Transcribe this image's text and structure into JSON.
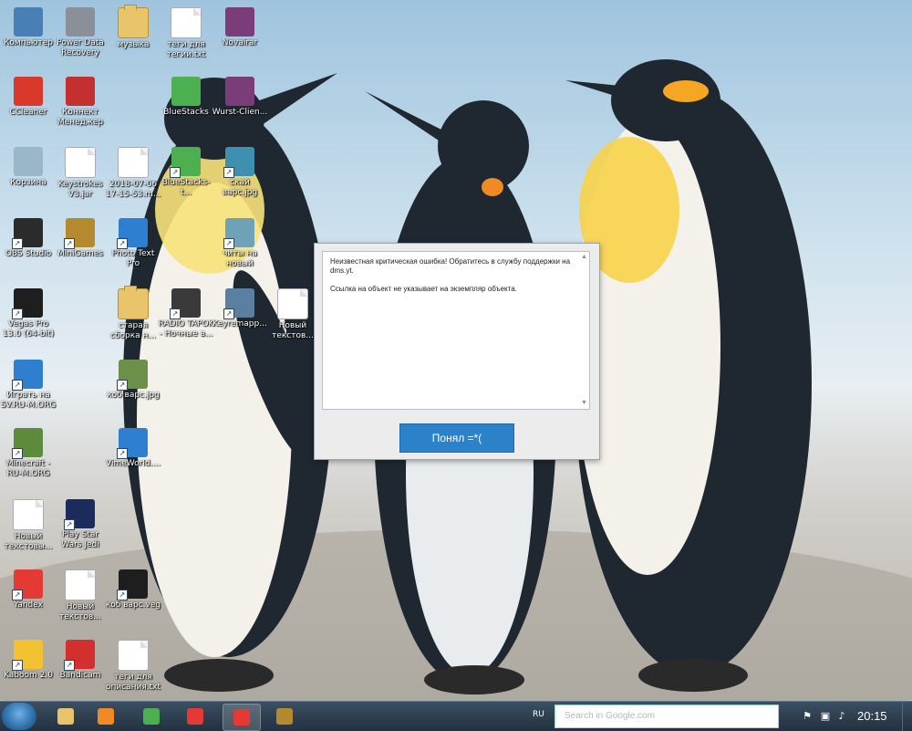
{
  "desktop": {
    "icons": [
      {
        "label": "Компьютер",
        "color": "#4a7fb5",
        "kind": "app"
      },
      {
        "label": "Power Data Recovery",
        "color": "#8a8f99",
        "kind": "app"
      },
      {
        "label": "музыка",
        "color": "#e9c46a",
        "kind": "folder"
      },
      {
        "label": "теги для тегии.txt",
        "color": "#ffffff",
        "kind": "doc"
      },
      {
        "label": "Novairar",
        "color": "#7a3d7a",
        "kind": "app"
      },
      {
        "label": "CCleaner",
        "color": "#d9382a",
        "kind": "app"
      },
      {
        "label": "Коннект Менеджер",
        "color": "#c42f2f",
        "kind": "app"
      },
      {
        "label": "BlueStacks",
        "color": "#4caf50",
        "kind": "app"
      },
      {
        "label": "Wurst-Clien...",
        "color": "#7a3d7a",
        "kind": "app"
      },
      {
        "label": "Корзина",
        "color": "#9ab6c9",
        "kind": "app"
      },
      {
        "label": "Keystrokes V3.jar",
        "color": "#f0f0f0",
        "kind": "doc"
      },
      {
        "label": "2018-07-06 17-15-53.m...",
        "color": "#ffffff",
        "kind": "doc"
      },
      {
        "label": "BlueStacks-t...",
        "color": "#4caf50",
        "kind": "app"
      },
      {
        "label": "скай варс.jpg",
        "color": "#3e8fb0",
        "kind": "app"
      },
      {
        "label": "OBS Studio",
        "color": "#2b2b2b",
        "kind": "app"
      },
      {
        "label": "MiniGames",
        "color": "#b58a2e",
        "kind": "app"
      },
      {
        "label": "Photo Text Pro",
        "color": "#2f7fd1",
        "kind": "app"
      },
      {
        "label": "читы на новый варс.jpg",
        "color": "#6fa2b8",
        "kind": "app"
      },
      {
        "label": "Vegas Pro 13.0 (64-bit)",
        "color": "#1e1e1e",
        "kind": "app"
      },
      {
        "label": "старая сборка н...",
        "color": "#e9c46a",
        "kind": "folder"
      },
      {
        "label": "RADIO TAPOK - Ночные в...",
        "color": "#3a3a3a",
        "kind": "app"
      },
      {
        "label": "Keyremapp...",
        "color": "#5a7fa0",
        "kind": "app"
      },
      {
        "label": "Новый текстов...",
        "color": "#ffffff",
        "kind": "doc"
      },
      {
        "label": "Играть на SV.RU-M.ORG",
        "color": "#2f7fd1",
        "kind": "app"
      },
      {
        "label": "коб варс.jpg",
        "color": "#6c8f4a",
        "kind": "app"
      },
      {
        "label": "Minecraft - RU-M.ORG",
        "color": "#5d8b3b",
        "kind": "app"
      },
      {
        "label": "VimeWorld....",
        "color": "#2f7fd1",
        "kind": "app"
      },
      {
        "label": "Новый текстовы...",
        "color": "#ffffff",
        "kind": "doc"
      },
      {
        "label": "Play Star Wars Jedi Knight ...",
        "color": "#1a2b5c",
        "kind": "app"
      },
      {
        "label": "Yandex",
        "color": "#e53935",
        "kind": "app"
      },
      {
        "label": "Новый текстов...",
        "color": "#ffffff",
        "kind": "doc"
      },
      {
        "label": "коб варс.veg",
        "color": "#1e1e1e",
        "kind": "app"
      },
      {
        "label": "Kaboom 2.0",
        "color": "#f2c230",
        "kind": "app"
      },
      {
        "label": "Bandicam",
        "color": "#d32f2f",
        "kind": "app"
      },
      {
        "label": "теги для описания.txt",
        "color": "#ffffff",
        "kind": "doc"
      }
    ]
  },
  "dialog": {
    "message_line1": "Неизвестная критическая ошибка! Обратитесь в службу поддержки на dms.yt.",
    "message_line2": "Ссылка на объект не указывает на экземпляр объекта.",
    "ok_label": "Понял =*("
  },
  "taskbar": {
    "pinned": [
      {
        "name": "file-explorer",
        "color": "#e9c46a",
        "active": false
      },
      {
        "name": "media-player",
        "color": "#f08a24",
        "active": false
      },
      {
        "name": "utorrent",
        "color": "#4caf50",
        "active": false
      },
      {
        "name": "yandex-browser",
        "color": "#e53935",
        "active": false
      },
      {
        "name": "yandex",
        "color": "#e53935",
        "active": true
      },
      {
        "name": "minigames",
        "color": "#b58a2e",
        "active": false
      }
    ],
    "language": "RU",
    "search_placeholder": "Search in Google.com",
    "time": "20:15"
  }
}
